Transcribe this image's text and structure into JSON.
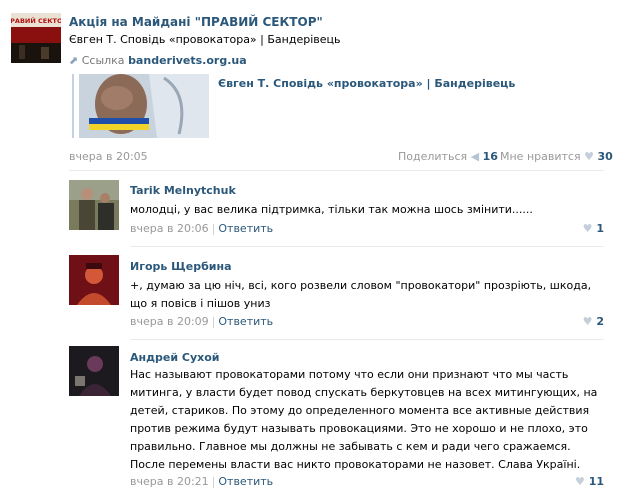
{
  "post": {
    "title": "Акція на Майдані \"ПРАВИЙ СЕКТОР\"",
    "avatar_text": "ПРАВИЙ СЕКТОР",
    "text": "Євген Т. Сповідь «провокатора» | Бандерівець",
    "link_prefix": "Ссылка",
    "link_domain": "banderivets.org.ua",
    "preview_title": "Євген Т. Сповідь «провокатора» | Бандерівець",
    "date": "вчера в 20:05",
    "share_label": "Поделиться",
    "share_count": "16",
    "like_label": "Мне нравится",
    "like_count": "30"
  },
  "comments": [
    {
      "name": "Tarik Melnytchuk",
      "text": "молодці, у вас велика підтримка, тільки так можна шось змінити......",
      "date": "вчера в 20:06",
      "reply": "Ответить",
      "likes": "1"
    },
    {
      "name": "Игорь Щербина",
      "text": "+, думаю за цю ніч, всі, кого розвели словом \"провокатори\" прозріють, шкода, що я повісв і пішов униз",
      "date": "вчера в 20:09",
      "reply": "Ответить",
      "likes": "2"
    },
    {
      "name": "Андрей Сухой",
      "text": "Нас называют провокаторами потому что если они признают что мы часть митинга, у власти будет повод спускать беркутовцев на всех митингующих, на детей, стариков. По этому до определенного момента все активные действия против режима будут называть провокациями. Это не хорошо и не плохо, это правильно. Главное мы должны не забывать с кем и ради чего сражаемся. После перемены власти вас никто провокаторами не назовет. Слава Україні.",
      "date": "вчера в 20:21",
      "reply": "Ответить",
      "likes": "11"
    }
  ],
  "colors": {
    "link": "#2b587a",
    "muted": "#999999",
    "divider": "#e7ebf0"
  }
}
